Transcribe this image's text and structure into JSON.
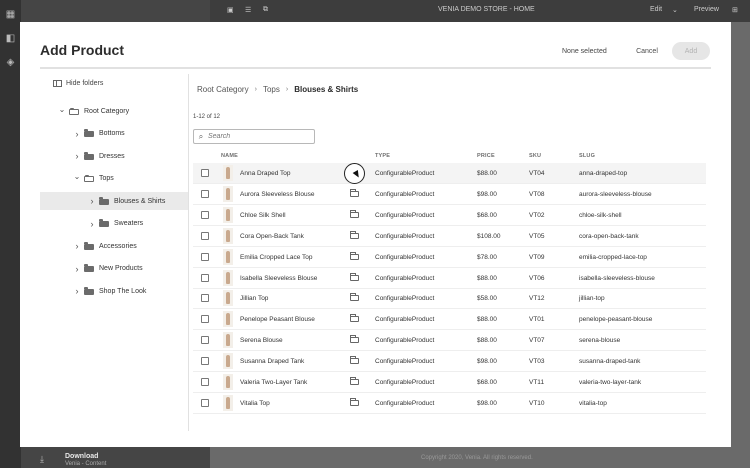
{
  "app": {
    "store_title": "VENIA DEMO STORE - HOME",
    "edit_label": "Edit",
    "preview_label": "Preview",
    "download_label": "Download",
    "download_sub": "Venia - Content",
    "copyright": "Copyright 2020, Venia. All rights reserved."
  },
  "modal": {
    "title": "Add Product",
    "status": "None selected",
    "cancel_label": "Cancel",
    "add_label": "Add"
  },
  "folders": {
    "hide_label": "Hide folders",
    "tree": [
      {
        "label": "Root Category",
        "level": 0,
        "expanded": true
      },
      {
        "label": "Bottoms",
        "level": 1,
        "expanded": false
      },
      {
        "label": "Dresses",
        "level": 1,
        "expanded": false
      },
      {
        "label": "Tops",
        "level": 1,
        "expanded": true
      },
      {
        "label": "Blouses & Shirts",
        "level": 2,
        "expanded": false,
        "selected": true
      },
      {
        "label": "Sweaters",
        "level": 2,
        "expanded": false
      },
      {
        "label": "Accessories",
        "level": 1,
        "expanded": false
      },
      {
        "label": "New Products",
        "level": 1,
        "expanded": false
      },
      {
        "label": "Shop The Look",
        "level": 1,
        "expanded": false
      }
    ]
  },
  "breadcrumb": [
    "Root Category",
    "Tops",
    "Blouses & Shirts"
  ],
  "count_label": "1-12 of 12",
  "search": {
    "placeholder": "Search"
  },
  "table": {
    "columns": {
      "name": "NAME",
      "type": "TYPE",
      "price": "PRICE",
      "sku": "SKU",
      "slug": "SLUG"
    },
    "rows": [
      {
        "name": "Anna Draped Top",
        "type": "ConfigurableProduct",
        "price": "$88.00",
        "sku": "VT04",
        "slug": "anna-draped-top"
      },
      {
        "name": "Aurora Sleeveless Blouse",
        "type": "ConfigurableProduct",
        "price": "$98.00",
        "sku": "VT08",
        "slug": "aurora-sleeveless-blouse"
      },
      {
        "name": "Chloe Silk Shell",
        "type": "ConfigurableProduct",
        "price": "$68.00",
        "sku": "VT02",
        "slug": "chloe-silk-shell"
      },
      {
        "name": "Cora Open-Back Tank",
        "type": "ConfigurableProduct",
        "price": "$108.00",
        "sku": "VT05",
        "slug": "cora-open-back-tank"
      },
      {
        "name": "Emilia Cropped Lace Top",
        "type": "ConfigurableProduct",
        "price": "$78.00",
        "sku": "VT09",
        "slug": "emilia-cropped-lace-top"
      },
      {
        "name": "Isabella Sleeveless Blouse",
        "type": "ConfigurableProduct",
        "price": "$88.00",
        "sku": "VT06",
        "slug": "isabella-sleeveless-blouse"
      },
      {
        "name": "Jillian Top",
        "type": "ConfigurableProduct",
        "price": "$58.00",
        "sku": "VT12",
        "slug": "jillian-top"
      },
      {
        "name": "Penelope Peasant Blouse",
        "type": "ConfigurableProduct",
        "price": "$88.00",
        "sku": "VT01",
        "slug": "penelope-peasant-blouse"
      },
      {
        "name": "Serena Blouse",
        "type": "ConfigurableProduct",
        "price": "$88.00",
        "sku": "VT07",
        "slug": "serena-blouse"
      },
      {
        "name": "Susanna Draped Tank",
        "type": "ConfigurableProduct",
        "price": "$98.00",
        "sku": "VT03",
        "slug": "susanna-draped-tank"
      },
      {
        "name": "Valeria Two-Layer Tank",
        "type": "ConfigurableProduct",
        "price": "$68.00",
        "sku": "VT11",
        "slug": "valeria-two-layer-tank"
      },
      {
        "name": "Vitalia Top",
        "type": "ConfigurableProduct",
        "price": "$98.00",
        "sku": "VT10",
        "slug": "vitalia-top"
      }
    ]
  }
}
